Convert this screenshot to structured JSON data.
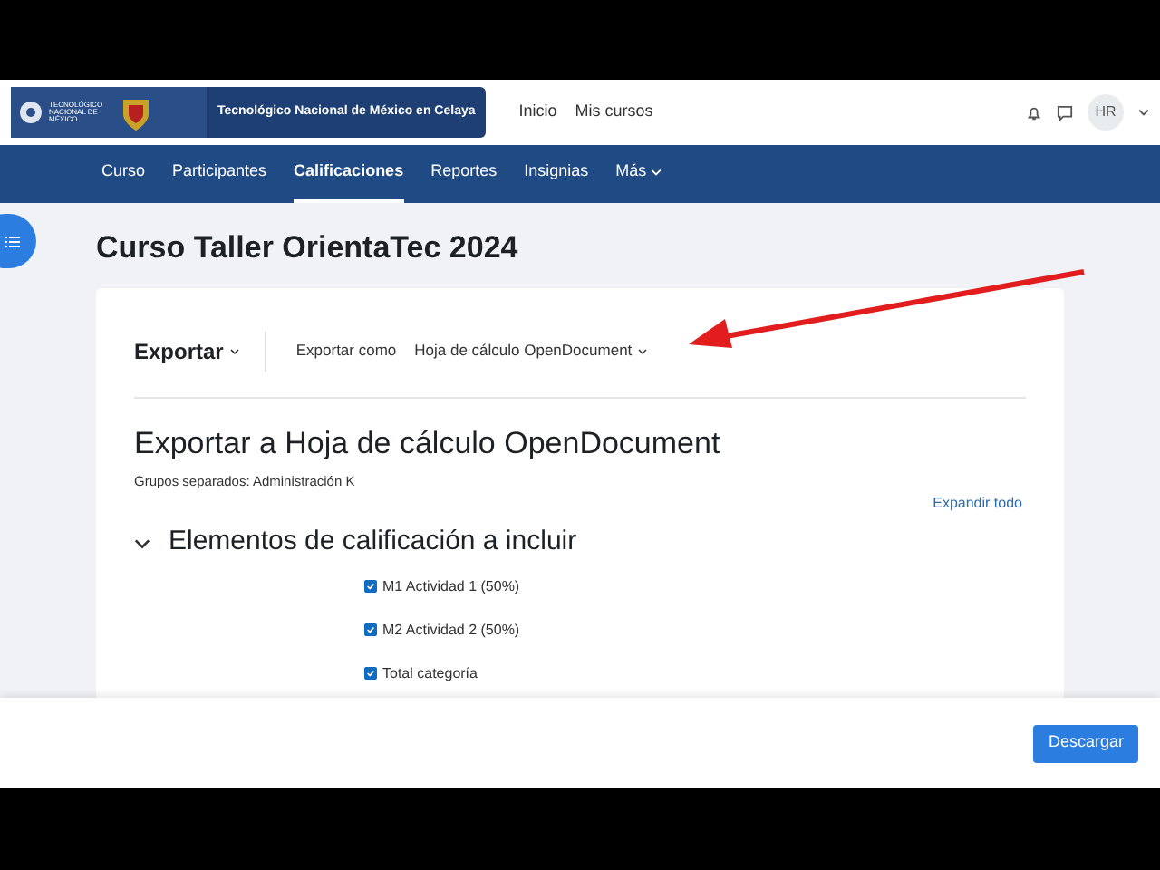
{
  "header": {
    "logo_text": "TECNOLÓGICO NACIONAL DE MÉXICO",
    "site_name": "Tecnológico Nacional de México en Celaya",
    "links": [
      "Inicio",
      "Mis cursos"
    ],
    "avatar": "HR"
  },
  "nav": [
    {
      "label": "Curso",
      "selected": false,
      "dropdown": false
    },
    {
      "label": "Participantes",
      "selected": false,
      "dropdown": false
    },
    {
      "label": "Calificaciones",
      "selected": true,
      "dropdown": false
    },
    {
      "label": "Reportes",
      "selected": false,
      "dropdown": false
    },
    {
      "label": "Insignias",
      "selected": false,
      "dropdown": false
    },
    {
      "label": "Más",
      "selected": false,
      "dropdown": true
    }
  ],
  "page_title": "Curso Taller OrientaTec 2024",
  "action_bar": {
    "menu": "Exportar",
    "label": "Exportar como",
    "format": "Hoja de cálculo OpenDocument"
  },
  "heading": "Exportar a Hoja de cálculo OpenDocument",
  "groups": "Grupos separados: Administración K",
  "expand_all": "Expandir todo",
  "section": {
    "title": "Elementos de calificación a incluir",
    "expanded": true,
    "items": [
      {
        "label": "M1 Actividad 1 (50%)",
        "checked": true
      },
      {
        "label": "M2 Actividad 2 (50%)",
        "checked": true
      },
      {
        "label": "Total categoría",
        "checked": true
      }
    ]
  },
  "footer_button": "Descargar"
}
